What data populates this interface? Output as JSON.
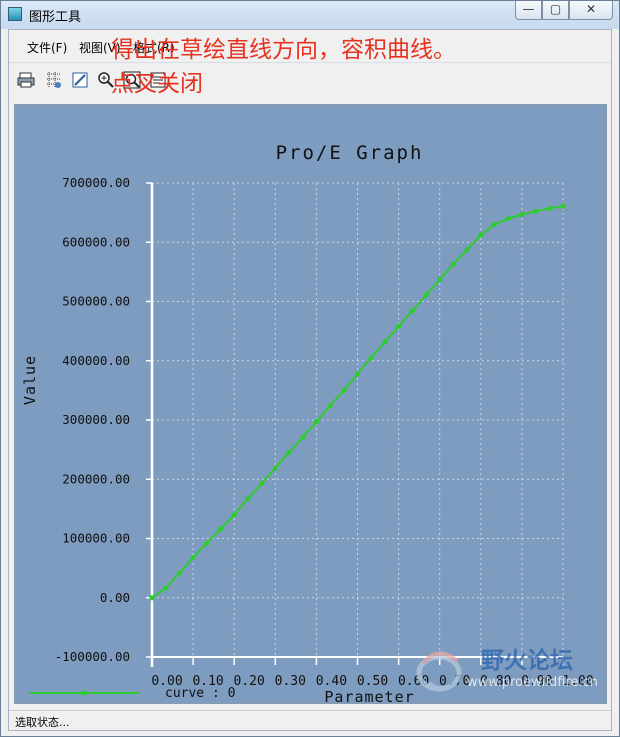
{
  "window": {
    "title": "图形工具",
    "controls": {
      "minimize": "—",
      "maximize": "▢",
      "close": "✕"
    }
  },
  "menu": [
    "文件(F)",
    "视图(V)",
    "格式(R)"
  ],
  "annotation": "得出在草绘直线方向，容积曲线。\n点叉关闭",
  "chart_data": {
    "type": "line",
    "title": "Pro/E Graph",
    "xlabel": "Parameter",
    "ylabel": "Value",
    "xlim": [
      0,
      1
    ],
    "ylim": [
      -100000,
      700000
    ],
    "x_ticks": [
      "0.00",
      "0.10",
      "0.20",
      "0.30",
      "0.40",
      "0.50",
      "0.60",
      "0.70",
      "0.80",
      "0.90",
      "1.00"
    ],
    "y_ticks": [
      "700000.00",
      "600000.00",
      "500000.00",
      "400000.00",
      "300000.00",
      "200000.00",
      "100000.00",
      "0.00",
      "-100000.00"
    ],
    "grid": true,
    "series": [
      {
        "name": "curve : 0",
        "color": "#2ecc2e",
        "x": [
          0.0,
          0.033,
          0.067,
          0.1,
          0.133,
          0.167,
          0.2,
          0.233,
          0.267,
          0.3,
          0.333,
          0.367,
          0.4,
          0.433,
          0.467,
          0.5,
          0.533,
          0.567,
          0.6,
          0.633,
          0.667,
          0.7,
          0.733,
          0.767,
          0.8,
          0.833,
          0.867,
          0.9,
          0.933,
          0.967,
          1.0
        ],
        "values": [
          0,
          16000,
          42000,
          68000,
          92000,
          116000,
          140000,
          167000,
          193000,
          219000,
          245000,
          271000,
          297000,
          324000,
          350000,
          378000,
          405000,
          432000,
          458000,
          484000,
          511000,
          537000,
          563000,
          588000,
          612000,
          630000,
          640000,
          647000,
          652000,
          657000,
          661000
        ]
      }
    ]
  },
  "legend": {
    "label": "curve : 0"
  },
  "status": "选取状态...",
  "watermark": {
    "title": "野火论坛",
    "url": "www.proewildfire.cn"
  }
}
